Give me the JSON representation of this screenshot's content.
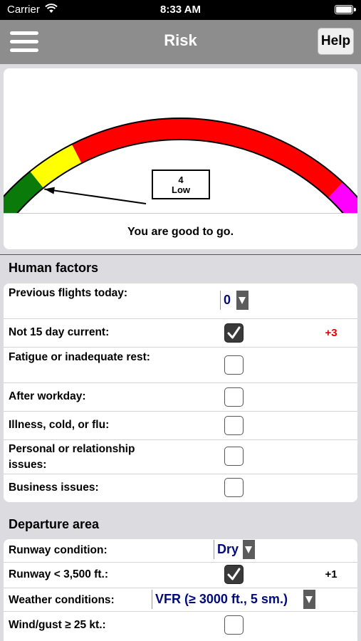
{
  "status_bar": {
    "carrier": "Carrier",
    "time": "8:33 AM"
  },
  "nav": {
    "title": "Risk",
    "help_label": "Help"
  },
  "gauge": {
    "score": "4",
    "level": "Low",
    "message": "You are good to go.",
    "colors": {
      "green": "#0a7a0a",
      "yellow": "#ffff00",
      "red": "#ff0000",
      "magenta": "#ff00ff"
    }
  },
  "human_factors": {
    "title": "Human factors",
    "rows": [
      {
        "label": "Previous flights today:",
        "type": "select",
        "value": "0"
      },
      {
        "label": "Not 15 day current:",
        "type": "checkbox",
        "checked": true,
        "points": "+3"
      },
      {
        "label": "Fatigue or inadequate rest:",
        "type": "checkbox",
        "checked": false
      },
      {
        "label": "After workday:",
        "type": "checkbox",
        "checked": false
      },
      {
        "label": "Illness, cold, or flu:",
        "type": "checkbox",
        "checked": false
      },
      {
        "label": "Personal or relationship issues:",
        "type": "checkbox",
        "checked": false
      },
      {
        "label": "Business issues:",
        "type": "checkbox",
        "checked": false
      }
    ]
  },
  "departure_area": {
    "title": "Departure area",
    "rows": [
      {
        "label": "Runway condition:",
        "type": "select",
        "value": "Dry"
      },
      {
        "label": "Runway < 3,500 ft.:",
        "type": "checkbox",
        "checked": true,
        "points": "+1"
      },
      {
        "label": "Weather conditions:",
        "type": "select",
        "value": "VFR (≥ 3000 ft., 5 sm.)"
      },
      {
        "label": "Wind/gust ≥ 25 kt.:",
        "type": "checkbox",
        "checked": false
      }
    ]
  }
}
